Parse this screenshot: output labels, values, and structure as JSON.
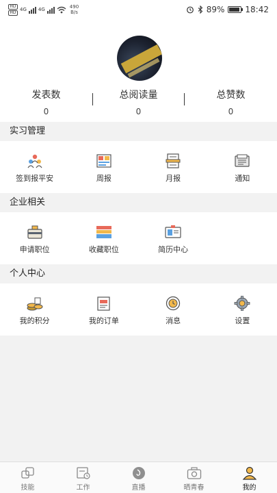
{
  "status": {
    "hd1": "HD",
    "hd2": "HD",
    "net1": "4G",
    "net2": "4G",
    "speed_value": "490",
    "speed_unit": "B/s",
    "battery": "89%",
    "time": "18:42"
  },
  "profile": {
    "stats": [
      {
        "label": "发表数",
        "value": "0"
      },
      {
        "label": "总阅读量",
        "value": "0"
      },
      {
        "label": "总赞数",
        "value": "0"
      }
    ]
  },
  "sections": [
    {
      "title": "实习管理",
      "items": [
        {
          "label": "签到报平安",
          "icon": "people-check-icon"
        },
        {
          "label": "周报",
          "icon": "weekly-report-icon"
        },
        {
          "label": "月报",
          "icon": "monthly-report-icon"
        },
        {
          "label": "通知",
          "icon": "notice-icon"
        }
      ]
    },
    {
      "title": "企业相关",
      "items": [
        {
          "label": "申请职位",
          "icon": "briefcase-icon"
        },
        {
          "label": "收藏职位",
          "icon": "stack-books-icon"
        },
        {
          "label": "简历中心",
          "icon": "id-card-icon"
        }
      ]
    },
    {
      "title": "个人中心",
      "items": [
        {
          "label": "我的积分",
          "icon": "coins-icon"
        },
        {
          "label": "我的订单",
          "icon": "order-icon"
        },
        {
          "label": "消息",
          "icon": "message-icon"
        },
        {
          "label": "设置",
          "icon": "gear-icon"
        }
      ]
    }
  ],
  "tabbar": [
    {
      "label": "技能",
      "icon": "skill-icon"
    },
    {
      "label": "工作",
      "icon": "work-icon"
    },
    {
      "label": "直播",
      "icon": "live-icon"
    },
    {
      "label": "晒青春",
      "icon": "camera-icon"
    },
    {
      "label": "我的",
      "icon": "user-icon",
      "active": true
    }
  ],
  "colors": {
    "accent": "#f2b84b",
    "background": "#f2f2f2",
    "card": "#ffffff"
  }
}
